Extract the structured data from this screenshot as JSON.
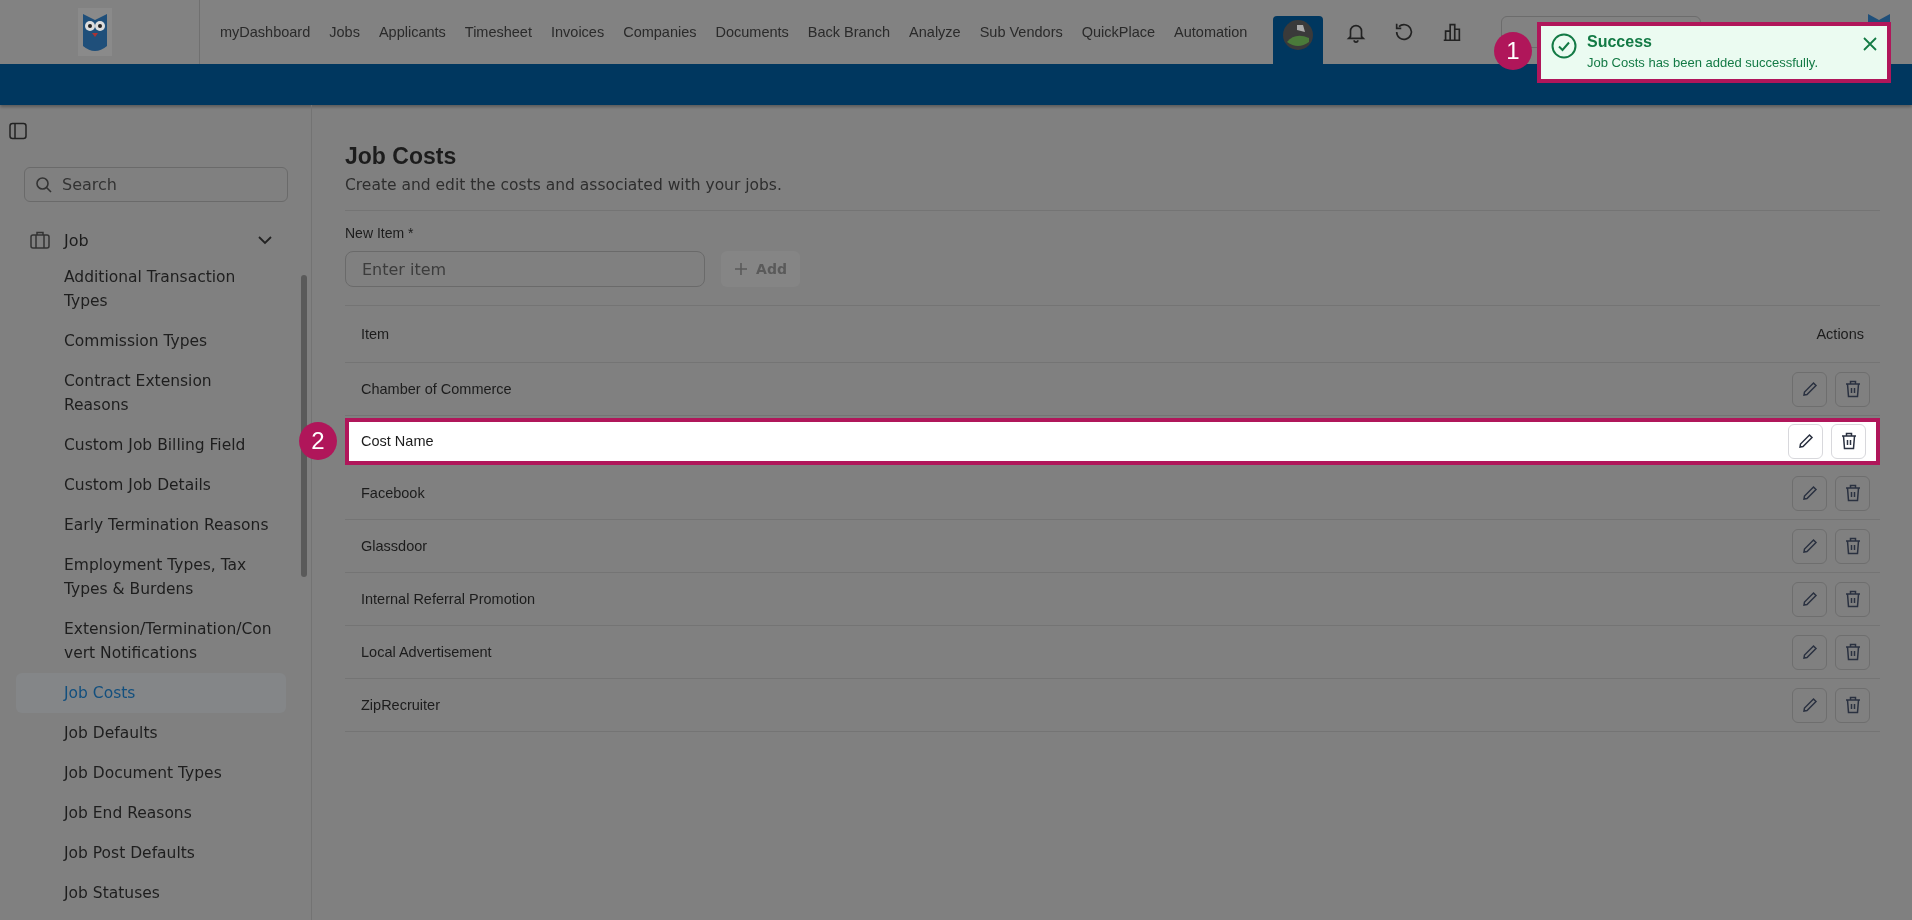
{
  "nav": {
    "items": [
      {
        "label": "myDashboard"
      },
      {
        "label": "Jobs"
      },
      {
        "label": "Applicants"
      },
      {
        "label": "Timesheet"
      },
      {
        "label": "Invoices"
      },
      {
        "label": "Companies"
      },
      {
        "label": "Documents"
      },
      {
        "label": "Back Branch"
      },
      {
        "label": "Analyze"
      },
      {
        "label": "Sub Vendors"
      },
      {
        "label": "QuickPlace"
      },
      {
        "label": "Automation"
      }
    ]
  },
  "toast": {
    "callout": "1",
    "title": "Success",
    "message": "Job Costs has been added successfully."
  },
  "sidebar": {
    "search": {
      "placeholder": "Search"
    },
    "group": {
      "label": "Job",
      "expanded": true,
      "children": [
        {
          "label": "Additional Transaction Types",
          "selected": false
        },
        {
          "label": "Commission Types",
          "selected": false
        },
        {
          "label": "Contract Extension Reasons",
          "selected": false
        },
        {
          "label": "Custom Job Billing Field",
          "selected": false
        },
        {
          "label": "Custom Job Details",
          "selected": false
        },
        {
          "label": "Early Termination Reasons",
          "selected": false
        },
        {
          "label": "Employment Types, Tax Types & Burdens",
          "selected": false
        },
        {
          "label": "Extension/Termination/Convert Notifications",
          "selected": false
        },
        {
          "label": "Job Costs",
          "selected": true
        },
        {
          "label": "Job Defaults",
          "selected": false
        },
        {
          "label": "Job Document Types",
          "selected": false
        },
        {
          "label": "Job End Reasons",
          "selected": false
        },
        {
          "label": "Job Post Defaults",
          "selected": false
        },
        {
          "label": "Job Statuses",
          "selected": false
        }
      ]
    }
  },
  "page": {
    "title": "Job Costs",
    "subtitle": "Create and edit the costs and associated with your jobs.",
    "new_item": {
      "label": "New Item",
      "required_mark": "*",
      "placeholder": "Enter item",
      "button": "Add"
    },
    "table": {
      "columns": [
        "Item",
        "Actions"
      ],
      "rows": [
        {
          "item": "Chamber of Commerce",
          "highlighted": false
        },
        {
          "item": "Cost Name",
          "highlighted": true,
          "callout": "2"
        },
        {
          "item": "Facebook",
          "highlighted": false
        },
        {
          "item": "Glassdoor",
          "highlighted": false
        },
        {
          "item": "Internal Referral Promotion",
          "highlighted": false
        },
        {
          "item": "Local Advertisement",
          "highlighted": false
        },
        {
          "item": "ZipRecruiter",
          "highlighted": false
        }
      ]
    }
  }
}
